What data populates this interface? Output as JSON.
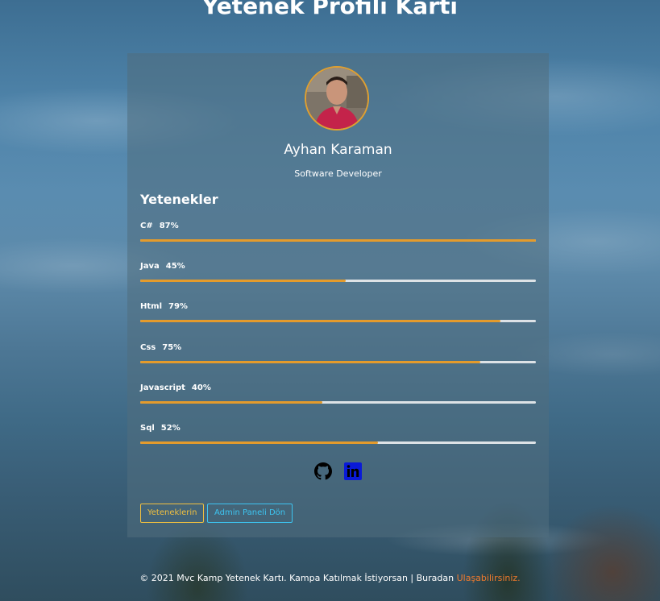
{
  "page": {
    "title": "Yetenek Profili Kartı"
  },
  "profile": {
    "name": "Ayhan Karaman",
    "role": "Software Developer"
  },
  "skills": {
    "heading": "Yetenekler",
    "items": [
      {
        "label": "C#",
        "percent_text": "87%",
        "value": 100
      },
      {
        "label": "Java",
        "percent_text": "45%",
        "value": 52
      },
      {
        "label": "Html",
        "percent_text": "79%",
        "value": 91
      },
      {
        "label": "Css",
        "percent_text": "75%",
        "value": 86
      },
      {
        "label": "Javascript",
        "percent_text": "40%",
        "value": 46
      },
      {
        "label": "Sql",
        "percent_text": "52%",
        "value": 60
      }
    ]
  },
  "socials": {
    "items": [
      {
        "icon": "github-icon",
        "color": "#000000"
      },
      {
        "icon": "linkedin-icon",
        "color": "#0a1ad8"
      }
    ]
  },
  "buttons": {
    "skills_label": "Yeteneklerin",
    "admin_label": "Admin Paneli Dön"
  },
  "footer": {
    "text": "© 2021 Mvc Kamp Yetenek Kartı. Kampa Katılmak İstiyorsan | Buradan",
    "link_text": "Ulaşabilirsiniz."
  },
  "colors": {
    "skill_fill": "#e49b2c",
    "skill_track": "#dde2e6",
    "avatar_border": "#e0a030",
    "skills_button": "#f0c040",
    "admin_button": "#3dc4f0",
    "footer_link": "#f07a2c"
  }
}
